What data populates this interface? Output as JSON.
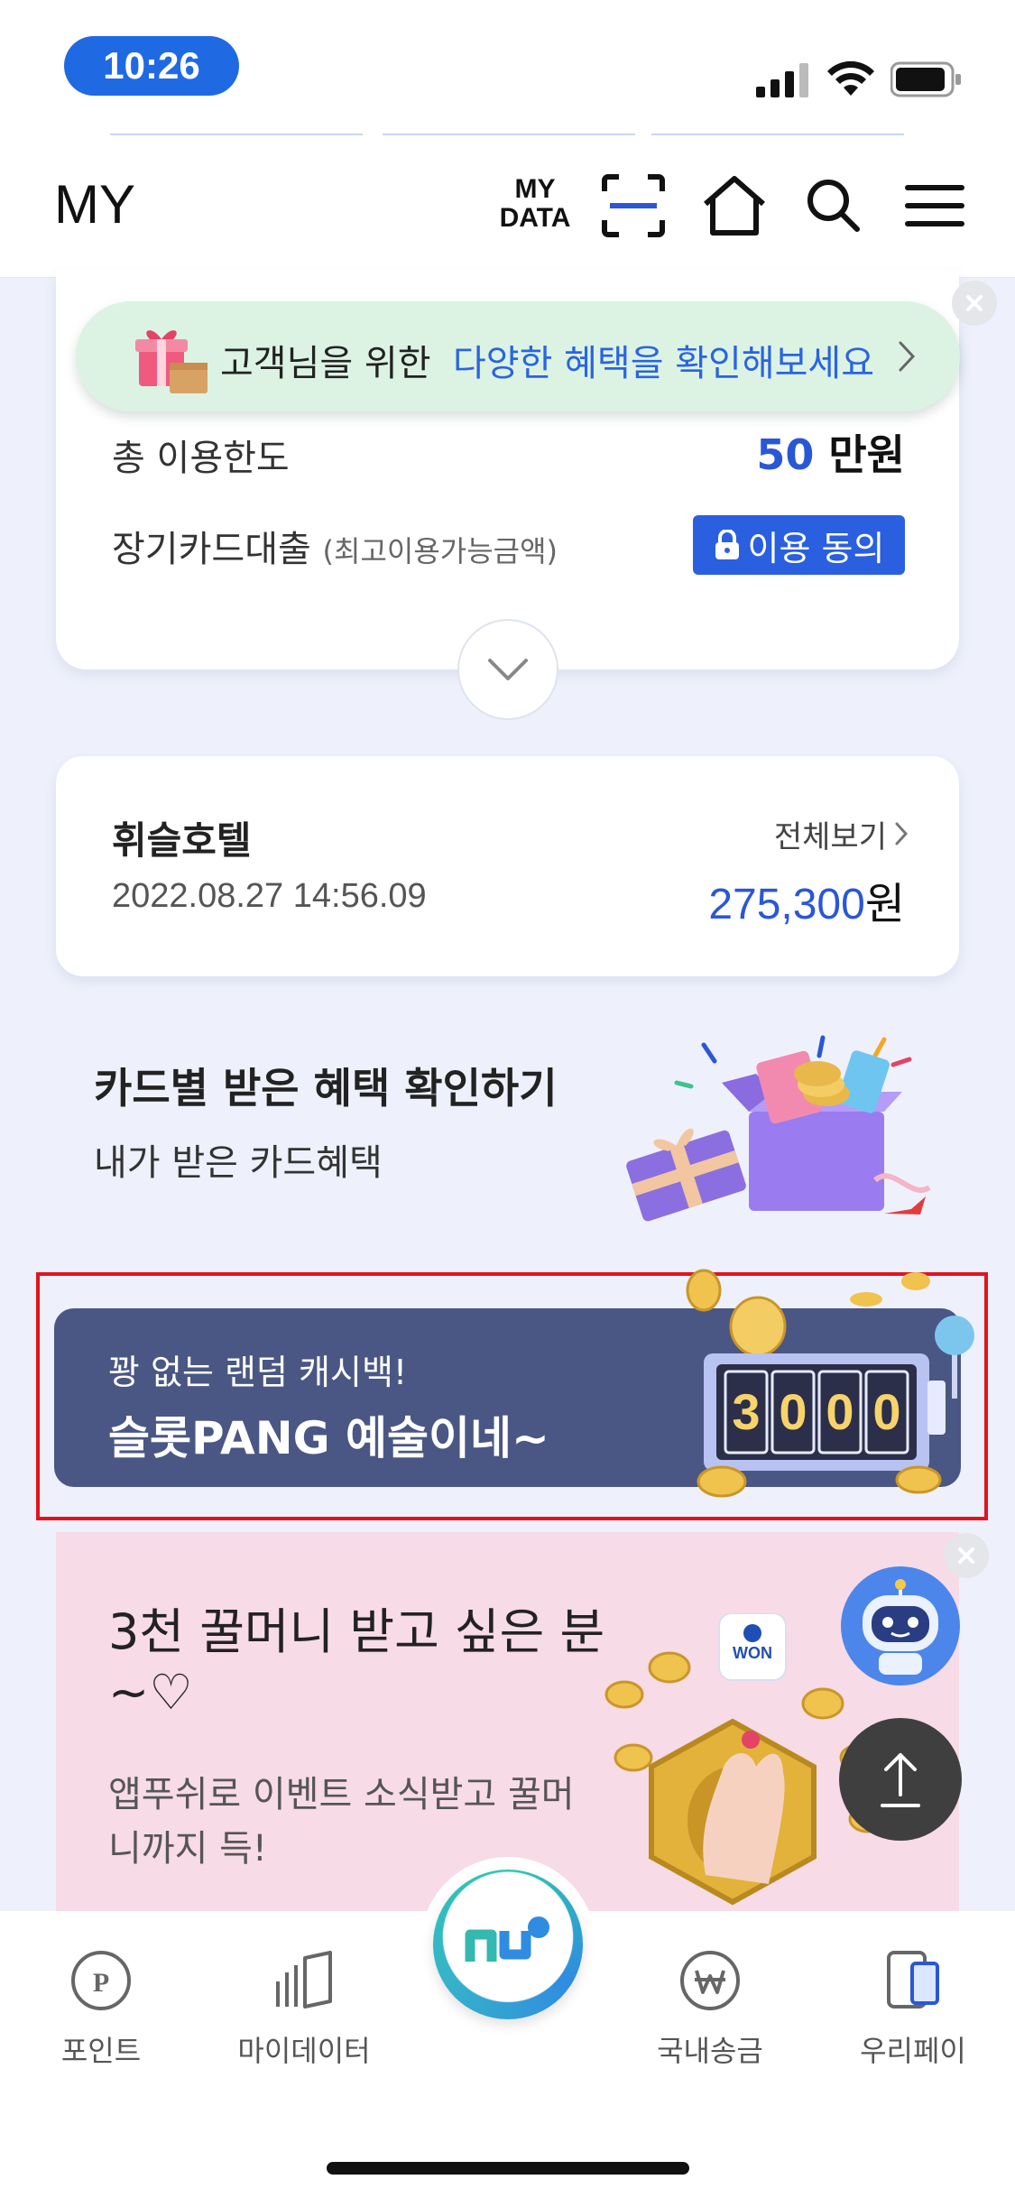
{
  "status_bar": {
    "time": "10:26"
  },
  "header": {
    "title": "MY",
    "mydata_line1": "MY",
    "mydata_line2": "DATA"
  },
  "benefit_banner": {
    "text_lead": "고객님을 위한",
    "text_highlight": "다양한 혜택을 확인해보세요"
  },
  "limit_card": {
    "total_limit_label": "총 이용한도",
    "total_limit_value": "50",
    "total_limit_unit": " 만원",
    "long_loan_label": "장기카드대출",
    "long_loan_sub": "(최고이용가능금액)",
    "agree_button": "이용 동의"
  },
  "transaction": {
    "merchant": "휘슬호텔",
    "datetime": "2022.08.27 14:56.09",
    "view_all": "전체보기",
    "amount": "275,300",
    "currency": "원"
  },
  "benefit_check": {
    "title": "카드별 받은 혜택 확인하기",
    "subtitle": "내가 받은 카드혜택"
  },
  "slot_banner": {
    "subtitle": "꽝 없는 랜덤 캐시백!",
    "title": "슬롯PANG 예술이네~",
    "digits": [
      "3",
      "0",
      "0",
      "0"
    ]
  },
  "promo": {
    "title_line1": "3천 꿀머니 받고 싶은 분",
    "title_line2": "~♡",
    "desc_line1": "앱푸쉬로 이벤트 소식받고 꿀머",
    "desc_line2": "니까지 득!",
    "won_badge": "WON"
  },
  "bottom_nav": {
    "items": [
      {
        "label": "포인트",
        "icon": "point-icon"
      },
      {
        "label": "마이데이터",
        "icon": "mydata-icon"
      },
      {
        "label": "국내송금",
        "icon": "transfer-icon"
      },
      {
        "label": "우리페이",
        "icon": "pay-icon"
      }
    ]
  },
  "colors": {
    "accent_blue": "#2a57d6",
    "time_pill": "#1f6ae3",
    "slot_banner_bg": "#4a5784",
    "promo_bg": "#f7dbe6",
    "benefit_banner_bg": "#dcf3e4",
    "highlight_outline": "#e0141e"
  }
}
